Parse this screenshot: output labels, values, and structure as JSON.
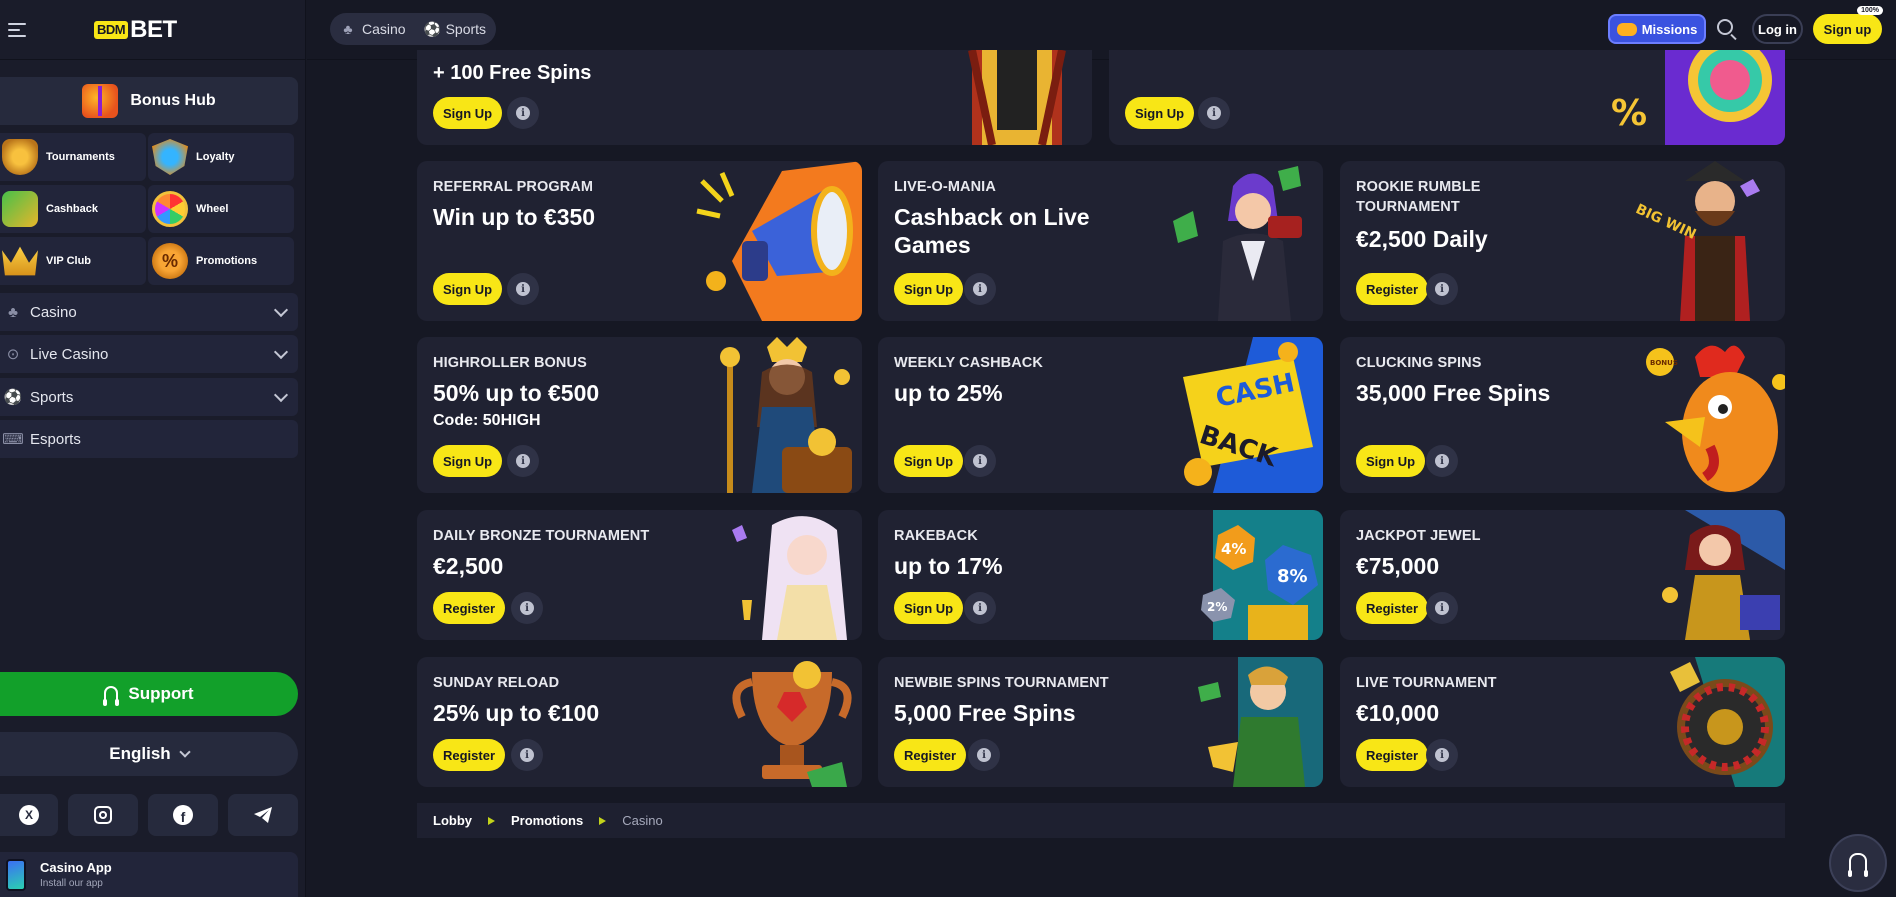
{
  "brand": {
    "logo_box": "BDM",
    "logo_text": "BET"
  },
  "sidebar": {
    "bonus_hub": "Bonus Hub",
    "grid": [
      {
        "label": "Tournaments",
        "icon": "trophy-icon"
      },
      {
        "label": "Loyalty",
        "icon": "shield-icon"
      },
      {
        "label": "Cashback",
        "icon": "cash-icon"
      },
      {
        "label": "Wheel",
        "icon": "wheel-icon"
      },
      {
        "label": "VIP Club",
        "icon": "crown-icon"
      },
      {
        "label": "Promotions",
        "icon": "percent-icon"
      }
    ],
    "nav": [
      {
        "label": "Casino",
        "icon": "cherry-icon"
      },
      {
        "label": "Live Casino",
        "icon": "broadcast-icon"
      },
      {
        "label": "Sports",
        "icon": "soccer-ball-icon"
      },
      {
        "label": "Esports",
        "icon": "gamepad-icon"
      }
    ],
    "support": "Support",
    "language": "English",
    "socials": [
      "x-icon",
      "instagram-icon",
      "facebook-icon",
      "telegram-icon"
    ],
    "app": {
      "title": "Casino App",
      "subtitle": "Install our app"
    }
  },
  "topbar": {
    "tabs": [
      {
        "label": "Casino",
        "icon": "cherry-icon"
      },
      {
        "label": "Sports",
        "icon": "soccer-ball-icon"
      }
    ],
    "missions": "Missions",
    "login": "Log in",
    "signup": "Sign up",
    "signup_badge": "100%"
  },
  "cards": [
    {
      "id": "c-top-left",
      "category": "",
      "title": "+ 100 Free Spins",
      "sub": "",
      "button": "Sign Up"
    },
    {
      "id": "c-top-right",
      "category": "",
      "title": "",
      "sub": "",
      "button": "Sign Up"
    },
    {
      "id": "c-referral",
      "category": "REFERRAL PROGRAM",
      "title": "Win up to €350",
      "sub": "",
      "button": "Sign Up"
    },
    {
      "id": "c-liveomania",
      "category": "LIVE-O-MANIA",
      "title": "Cashback on Live Games",
      "sub": "",
      "button": "Sign Up"
    },
    {
      "id": "c-rookie",
      "category": "ROOKIE RUMBLE TOURNAMENT",
      "title": "€2,500 Daily",
      "sub": "",
      "button": "Register"
    },
    {
      "id": "c-highroller",
      "category": "HIGHROLLER BONUS",
      "title": "50% up to €500",
      "sub": "Code: 50HIGH",
      "button": "Sign Up"
    },
    {
      "id": "c-weekly",
      "category": "WEEKLY CASHBACK",
      "title": "up to 25%",
      "sub": "",
      "button": "Sign Up"
    },
    {
      "id": "c-clucking",
      "category": "CLUCKING SPINS",
      "title": "35,000 Free Spins",
      "sub": "",
      "button": "Sign Up"
    },
    {
      "id": "c-bronze",
      "category": "DAILY BRONZE TOURNAMENT",
      "title": "€2,500",
      "sub": "",
      "button": "Register"
    },
    {
      "id": "c-rakeback",
      "category": "RAKEBACK",
      "title": "up to 17%",
      "sub": "",
      "button": "Sign Up"
    },
    {
      "id": "c-jackpot",
      "category": "JACKPOT JEWEL",
      "title": "€75,000",
      "sub": "",
      "button": "Register"
    },
    {
      "id": "c-sunday",
      "category": "SUNDAY RELOAD",
      "title": "25% up to €100",
      "sub": "",
      "button": "Register"
    },
    {
      "id": "c-newbie",
      "category": "NEWBIE SPINS TOURNAMENT",
      "title": "5,000 Free Spins",
      "sub": "",
      "button": "Register"
    },
    {
      "id": "c-live",
      "category": "LIVE TOURNAMENT",
      "title": "€10,000",
      "sub": "",
      "button": "Register"
    }
  ],
  "art_text": {
    "cash": "CASH",
    "back": "BACK",
    "bonus": "BONUS",
    "big_win": "BIG WIN",
    "pct8": "8%",
    "pct4": "4%",
    "pct2": "2%"
  },
  "breadcrumb": [
    "Lobby",
    "Promotions",
    "Casino"
  ],
  "colors": {
    "accent": "#f8e616",
    "bg": "#161824",
    "card": "#202232",
    "support_green": "#12a02a",
    "missions": "#3a52e0"
  }
}
